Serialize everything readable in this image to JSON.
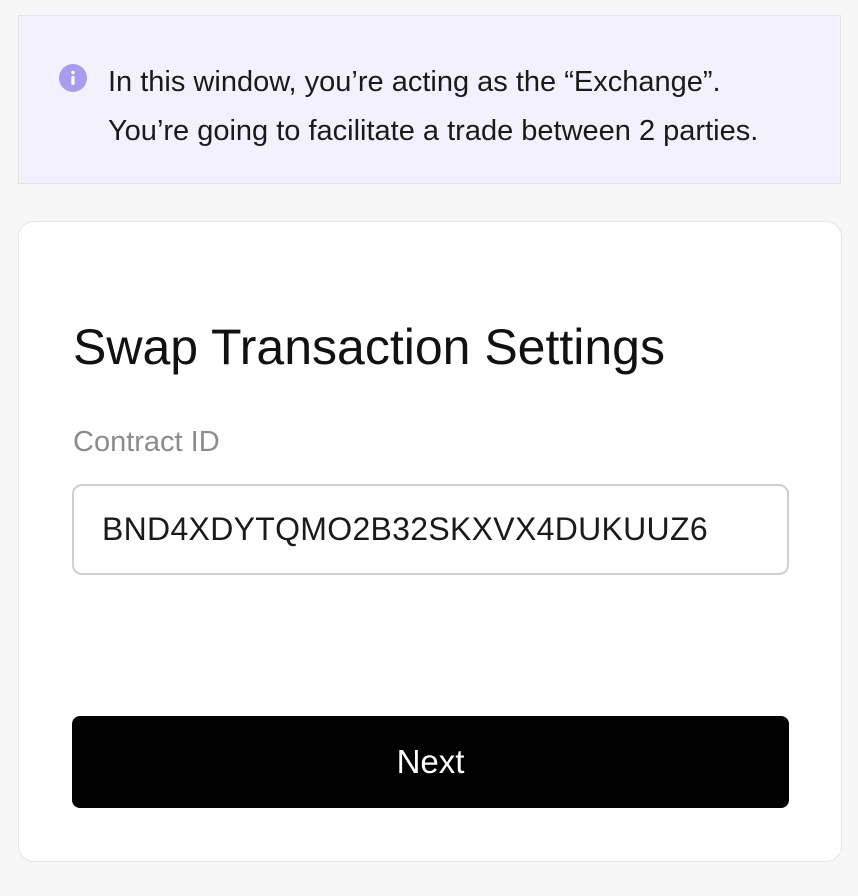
{
  "banner": {
    "icon": "info-icon",
    "line1": "In this window, you’re acting as the “Exchange”.",
    "line2": "You’re going to facilitate a trade between 2 parties."
  },
  "card": {
    "title": "Swap Transaction Settings",
    "contract_label": "Contract ID",
    "contract_value": "BND4XDYTQMO2B32SKXVX4DUKUUZ6",
    "next_label": "Next"
  },
  "colors": {
    "banner_bg": "#f3f1fd",
    "info_icon": "#a99bee",
    "button_bg": "#000000",
    "label_text": "#8c8c8c"
  }
}
